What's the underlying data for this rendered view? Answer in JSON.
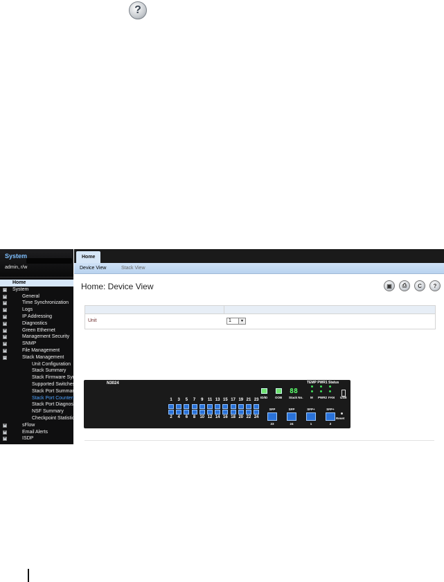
{
  "top_help": {
    "glyph": "?"
  },
  "sidebar": {
    "title": "System",
    "user": "admin, r/w",
    "items": [
      {
        "label": "Home",
        "level": 0,
        "box": ""
      },
      {
        "label": "System",
        "level": 0,
        "box": "−"
      },
      {
        "label": "General",
        "level": 1,
        "box": "+"
      },
      {
        "label": "Time Synchronization",
        "level": 1,
        "box": "+"
      },
      {
        "label": "Logs",
        "level": 1,
        "box": "+"
      },
      {
        "label": "IP Addressing",
        "level": 1,
        "box": "+"
      },
      {
        "label": "Diagnostics",
        "level": 1,
        "box": "+"
      },
      {
        "label": "Green Ethernet",
        "level": 1,
        "box": "+"
      },
      {
        "label": "Management Security",
        "level": 1,
        "box": "+"
      },
      {
        "label": "SNMP",
        "level": 1,
        "box": "+"
      },
      {
        "label": "File Management",
        "level": 1,
        "box": "+"
      },
      {
        "label": "Stack Management",
        "level": 1,
        "box": "−"
      },
      {
        "label": "Unit Configuration",
        "level": 2,
        "box": ""
      },
      {
        "label": "Stack Summary",
        "level": 2,
        "box": ""
      },
      {
        "label": "Stack Firmware Syn",
        "level": 2,
        "box": ""
      },
      {
        "label": "Supported Switches",
        "level": 2,
        "box": ""
      },
      {
        "label": "Stack Port Summar",
        "level": 2,
        "box": ""
      },
      {
        "label": "Stack Port Counters",
        "level": 2,
        "box": ""
      },
      {
        "label": "Stack Port Diagnost",
        "level": 2,
        "box": ""
      },
      {
        "label": "NSF Summary",
        "level": 2,
        "box": ""
      },
      {
        "label": "Checkpoint Statistic",
        "level": 2,
        "box": ""
      },
      {
        "label": "sFlow",
        "level": 1,
        "box": "+"
      },
      {
        "label": "Email Alerts",
        "level": 1,
        "box": "+"
      },
      {
        "label": "ISDP",
        "level": 1,
        "box": "+"
      }
    ]
  },
  "tabs": {
    "main": "Home",
    "device_view": "Device View",
    "stack_view": "Stack View"
  },
  "page_title": "Home: Device View",
  "toolbar": {
    "save_icon": "save-icon",
    "print_icon": "print-icon",
    "refresh_icon": "refresh-icon",
    "help_icon": "help-icon"
  },
  "unit_form": {
    "label": "Unit",
    "value": "1"
  },
  "device": {
    "model": "N3024",
    "status_title": "TEMP PWR1 Status",
    "top_ports": [
      "1",
      "3",
      "5",
      "7",
      "9",
      "11",
      "13",
      "15",
      "17",
      "19",
      "21",
      "23"
    ],
    "bottom_ports": [
      "2",
      "4",
      "6",
      "8",
      "10",
      "12",
      "14",
      "16",
      "18",
      "20",
      "22",
      "24"
    ],
    "leds": [
      "ID/ID",
      "OOB"
    ],
    "stack_no_value": "88",
    "stack_no_label": "Stack No.",
    "status_labels": [
      "M",
      "PWR2",
      "FAN",
      "USB"
    ],
    "sfp_labels": [
      "SFP",
      "SFP",
      "SFP+",
      "SFP+"
    ],
    "sfp_numbers": [
      "23",
      "24",
      "1",
      "2"
    ],
    "reset_label": "Reset"
  }
}
